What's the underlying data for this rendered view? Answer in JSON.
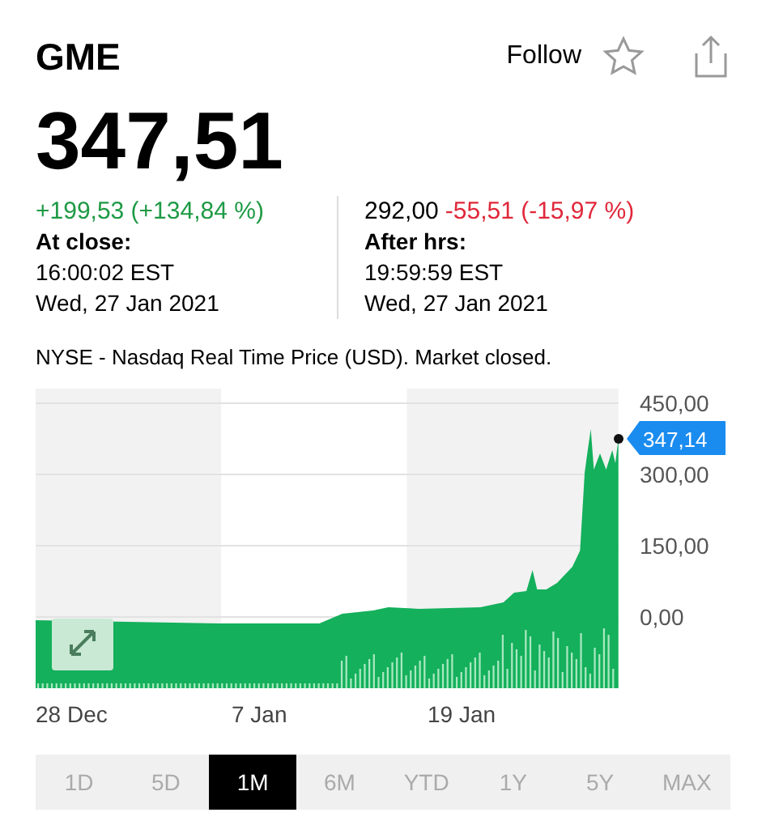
{
  "header": {
    "symbol": "GME",
    "follow_label": "Follow"
  },
  "quote": {
    "price": "347,51",
    "close": {
      "change": "+199,53 (+134,84 %)",
      "label": "At close:",
      "time": "16:00:02 EST",
      "date": "Wed, 27 Jan 2021"
    },
    "after_hours": {
      "price": "292,00",
      "change": "-55,51 (-15,97 %)",
      "label": "After hrs:",
      "time": "19:59:59 EST",
      "date": "Wed, 27 Jan 2021"
    }
  },
  "market_note": "NYSE - Nasdaq Real Time Price (USD). Market closed.",
  "chart": {
    "last_price_label": "347,14",
    "y_axis_labels": [
      "450,00",
      "300,00",
      "150,00",
      "0,00"
    ],
    "x_axis_labels": [
      "28 Dec",
      "7 Jan",
      "19 Jan"
    ]
  },
  "ranges": [
    {
      "label": "1D",
      "selected": false
    },
    {
      "label": "5D",
      "selected": false
    },
    {
      "label": "1M",
      "selected": true
    },
    {
      "label": "6M",
      "selected": false
    },
    {
      "label": "YTD",
      "selected": false
    },
    {
      "label": "1Y",
      "selected": false
    },
    {
      "label": "5Y",
      "selected": false
    },
    {
      "label": "MAX",
      "selected": false
    }
  ]
}
